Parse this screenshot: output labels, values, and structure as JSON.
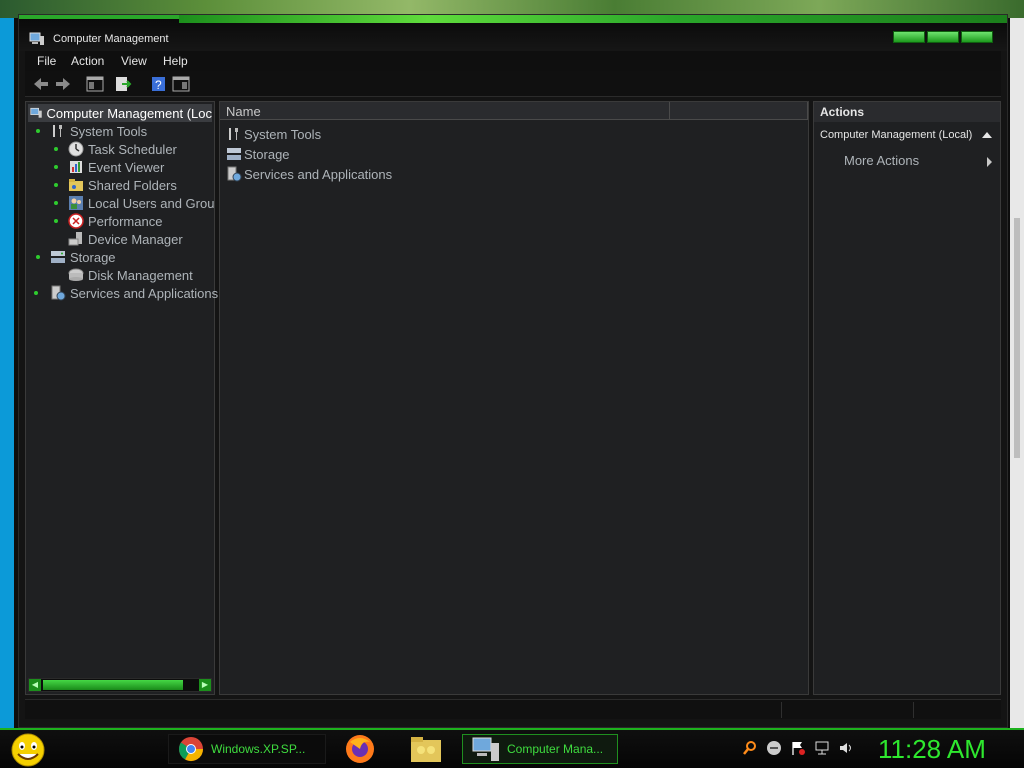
{
  "window": {
    "title": "Computer Management"
  },
  "menu": [
    "File",
    "Action",
    "View",
    "Help"
  ],
  "tree": {
    "root": "Computer Management (Loc",
    "items": [
      {
        "label": "System Tools",
        "level": 1,
        "icon": "tools-icon"
      },
      {
        "label": "Task Scheduler",
        "level": 2,
        "icon": "clock-icon"
      },
      {
        "label": "Event Viewer",
        "level": 2,
        "icon": "event-viewer-icon"
      },
      {
        "label": "Shared Folders",
        "level": 2,
        "icon": "shared-folders-icon"
      },
      {
        "label": "Local Users and Grou",
        "level": 2,
        "icon": "users-icon"
      },
      {
        "label": "Performance",
        "level": 2,
        "icon": "performance-icon"
      },
      {
        "label": "Device Manager",
        "level": 2,
        "icon": "device-manager-icon"
      },
      {
        "label": "Storage",
        "level": 1,
        "icon": "storage-icon"
      },
      {
        "label": "Disk Management",
        "level": 2,
        "icon": "disk-icon"
      },
      {
        "label": "Services and Applications",
        "level": 1,
        "icon": "services-icon"
      }
    ]
  },
  "list": {
    "column_name": "Name",
    "rows": [
      "System Tools",
      "Storage",
      "Services and Applications"
    ]
  },
  "actions": {
    "title": "Actions",
    "section": "Computer Management (Local)",
    "more": "More Actions"
  },
  "taskbar": {
    "buttons": [
      {
        "label": "Windows.XP.SP...",
        "icon": "chrome-icon"
      },
      {
        "label": "Computer Mana...",
        "icon": "computer-management-icon"
      }
    ],
    "clock": "11:28 AM"
  },
  "colors": {
    "accent": "#2ee82e",
    "pane": "#1f2022"
  }
}
